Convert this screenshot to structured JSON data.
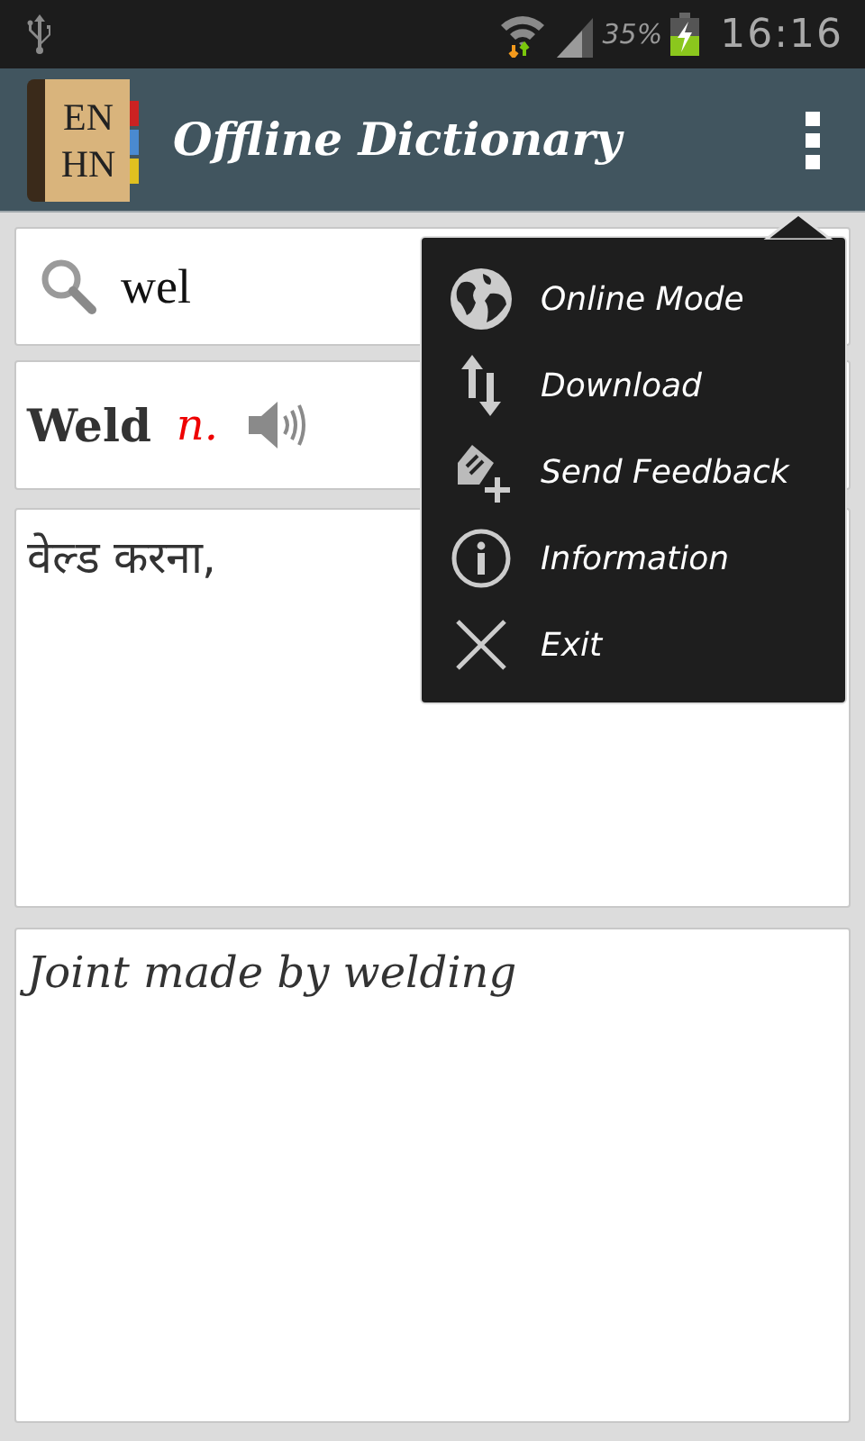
{
  "status_bar": {
    "battery": "35%",
    "time": "16:16"
  },
  "app_bar": {
    "title": "Offline Dictionary",
    "logo": [
      "EN",
      "HN"
    ]
  },
  "search": {
    "value": "wel"
  },
  "entry": {
    "word": "Weld",
    "part_of_speech": "n.",
    "translation": "वेल्ड  करना,",
    "definition": "Joint made by welding"
  },
  "menu": {
    "items": [
      {
        "kind": "globe",
        "label": "Online Mode"
      },
      {
        "kind": "transfer",
        "label": "Download"
      },
      {
        "kind": "feedback",
        "label": "Send Feedback"
      },
      {
        "kind": "info",
        "label": "Information"
      },
      {
        "kind": "exit",
        "label": "Exit"
      }
    ]
  }
}
